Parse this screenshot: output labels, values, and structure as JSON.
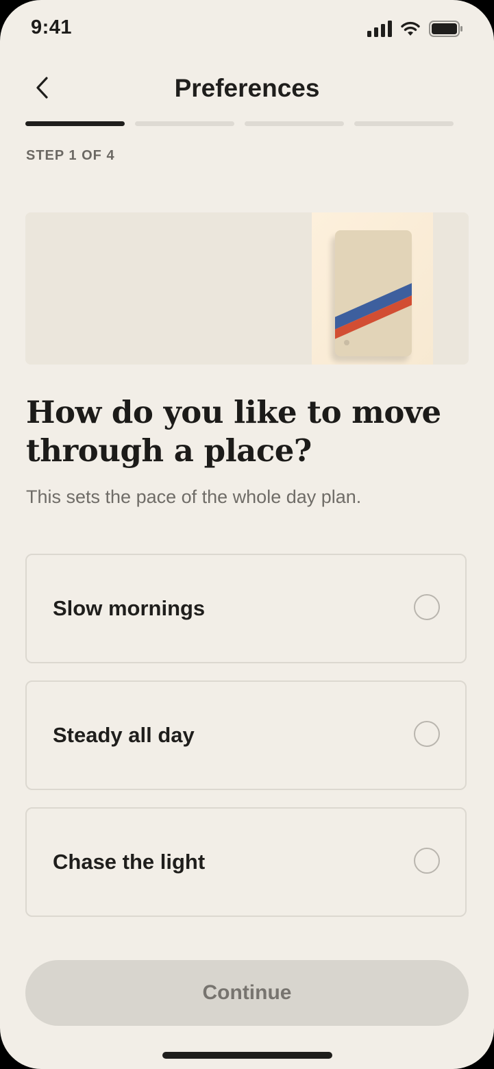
{
  "status_bar": {
    "time": "9:41",
    "icons": [
      "signal-icon",
      "wifi-icon",
      "battery-icon"
    ]
  },
  "header": {
    "back_icon": "chevron-left-icon",
    "title": "Preferences"
  },
  "progress": {
    "total_steps": 4,
    "current_step": 1
  },
  "step_label": "STEP 1 OF 4",
  "hero": {
    "description_icon": "card-illustration"
  },
  "question": {
    "title": "How do you like to move through a place?",
    "subtitle": "This sets the pace of the whole day plan."
  },
  "options": [
    {
      "label": "Slow mornings",
      "selected": false
    },
    {
      "label": "Steady all day",
      "selected": false
    },
    {
      "label": "Chase the light",
      "selected": false
    }
  ],
  "continue_button": {
    "label": "Continue",
    "enabled": false
  },
  "colors": {
    "background": "#f2eee7",
    "text_primary": "#1f1e1c",
    "text_secondary": "#6f6c67",
    "button_disabled_bg": "#d8d5ce",
    "stripe_blue": "#3d5f9e",
    "stripe_red": "#d24e33"
  }
}
